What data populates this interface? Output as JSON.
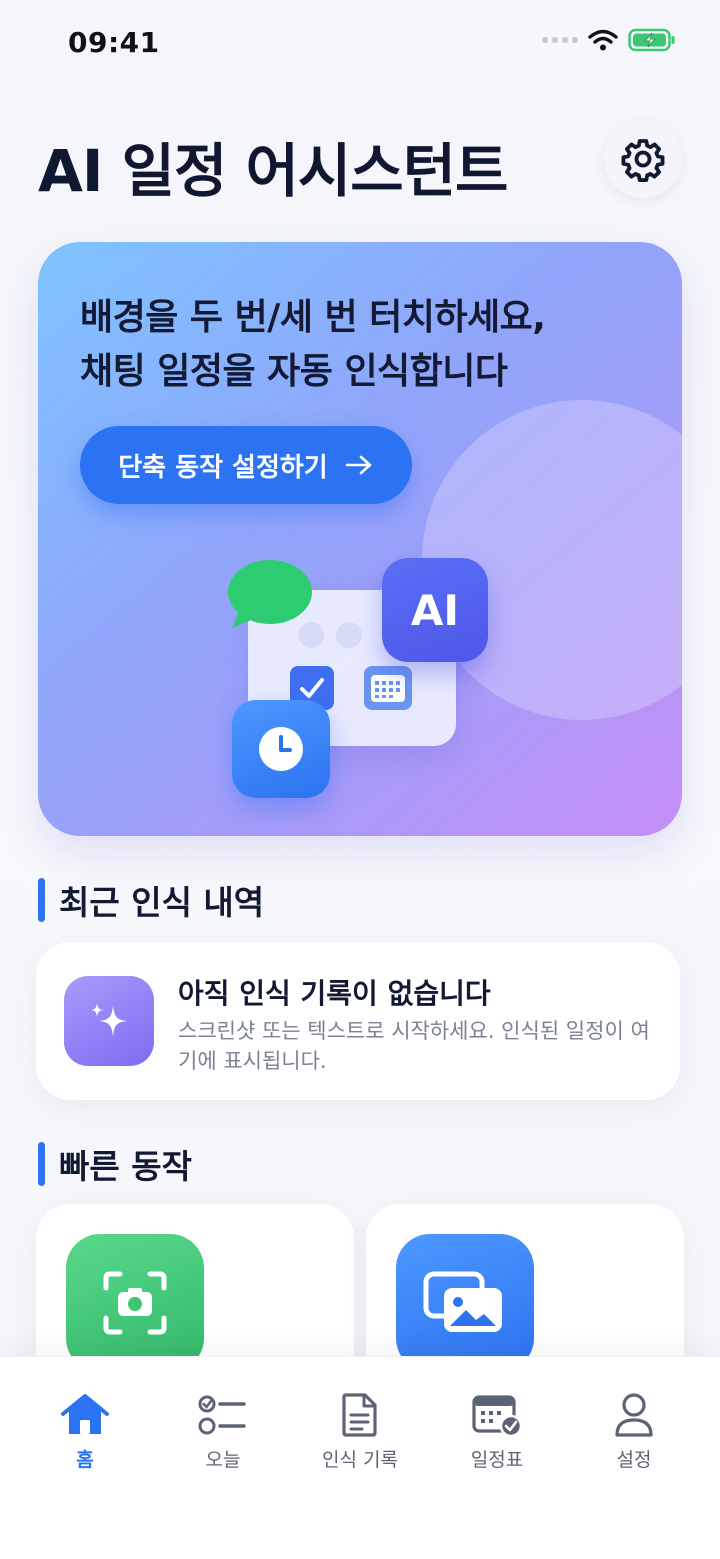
{
  "status_bar": {
    "time": "09:41"
  },
  "header": {
    "title": "AI 일정 어시스턴트"
  },
  "hero": {
    "line1": "배경을 두 번/세 번 터치하세요,",
    "line2": "채팅 일정을 자동 인식합니다",
    "cta_label": "단축 동작 설정하기",
    "badge_text": "AI"
  },
  "recent": {
    "title": "최근 인식 내역",
    "empty_title": "아직 인식 기록이 없습니다",
    "empty_desc": "스크린샷 또는 텍스트로 시작하세요. 인식된 일정이 여기에 표시됩니다."
  },
  "quick": {
    "title": "빠른 동작"
  },
  "tabs": [
    {
      "label": "홈",
      "icon": "home-icon",
      "active": true
    },
    {
      "label": "오늘",
      "icon": "checklist-icon",
      "active": false
    },
    {
      "label": "인식 기록",
      "icon": "document-icon",
      "active": false
    },
    {
      "label": "일정표",
      "icon": "calendar-check-icon",
      "active": false
    },
    {
      "label": "설정",
      "icon": "person-icon",
      "active": false
    }
  ],
  "colors": {
    "accent": "#2B73F3",
    "text": "#121A33",
    "muted": "#7C8293",
    "green": "#3CC873"
  }
}
